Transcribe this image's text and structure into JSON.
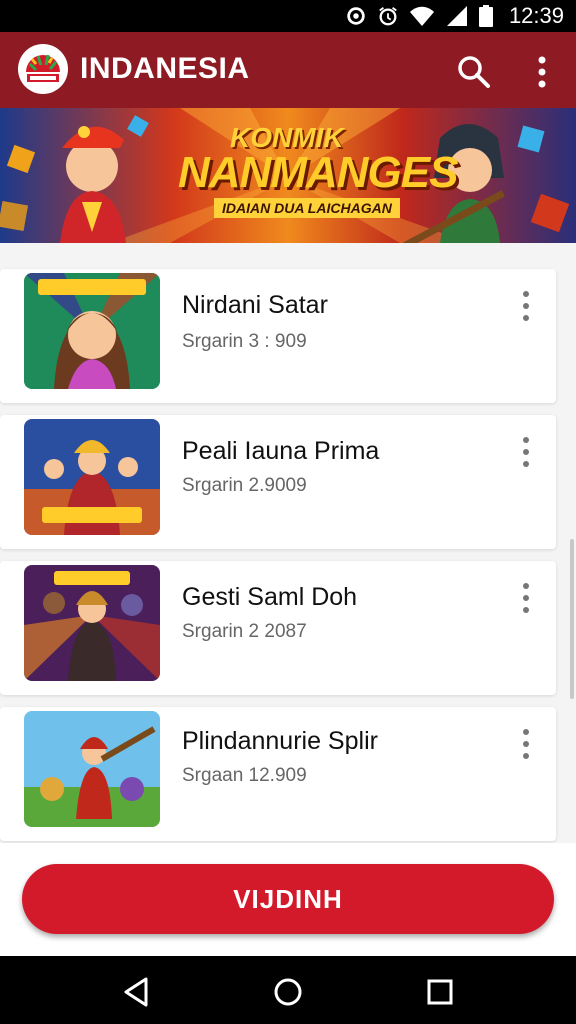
{
  "status_bar": {
    "time": "12:39"
  },
  "app_bar": {
    "title": "INDANESIA"
  },
  "banner": {
    "line1": "KONMIK",
    "line2": "NANMANGES",
    "subtitle": "IDAIAN DUA LAICHAGAN"
  },
  "items": [
    {
      "title": "Nirdani Satar",
      "subtitle": "Srgarin 3 : 909"
    },
    {
      "title": "Peali Iauna Prima",
      "subtitle": "Srgarin 2.9009"
    },
    {
      "title": "Gesti Saml Doh",
      "subtitle": "Srgarin 2 2087"
    },
    {
      "title": "Plindannurie Splir",
      "subtitle": "Srgaan 12.909"
    }
  ],
  "cta": {
    "label": "VIJDINH"
  },
  "icons": {
    "logo": "app-logo-icon",
    "search": "search-icon",
    "more": "more-vert-icon",
    "back": "nav-back-icon",
    "home": "nav-home-icon",
    "recents": "nav-recents-icon"
  },
  "colors": {
    "app_bar": "#8e1b24",
    "accent": "#d31a2b"
  }
}
